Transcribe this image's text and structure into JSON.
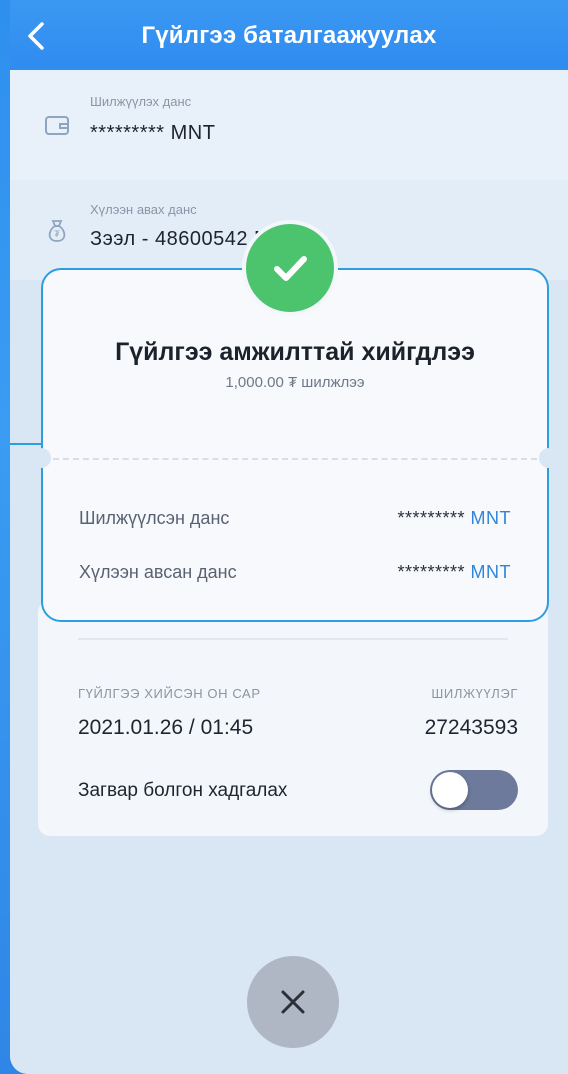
{
  "header": {
    "title": "Гүйлгээ баталгаажуулах"
  },
  "from_account": {
    "label": "Шилжүүлэх данс",
    "value": "********* MNT"
  },
  "to_account": {
    "label": "Хүлээн авах данс",
    "value": "Зээл - 48600542 MNT"
  },
  "modal": {
    "title": "Гүйлгээ амжилттай хийгдлээ",
    "subtitle": "1,000.00 ₮ шилжлээ",
    "rows": [
      {
        "label": "Шилжүүлсэн данс",
        "masked": "*********",
        "currency": "MNT"
      },
      {
        "label": "Хүлээн авсан данс",
        "masked": "*********",
        "currency": "MNT"
      }
    ]
  },
  "details": {
    "date_label": "ГҮЙЛГЭЭ ХИЙСЭН ОН САР",
    "date_value": "2021.01.26 / 01:45",
    "ref_label": "ШИЛЖҮҮЛЭГ",
    "ref_value": "27243593",
    "save_template_label": "Загвар болгон хадгалах",
    "save_template_on": false
  },
  "colors": {
    "accent": "#2f8cf0",
    "success": "#4cc46d",
    "popup_border": "#2d9de0",
    "toggle_off": "#6d7a9b"
  },
  "icons": [
    "chevron-left-icon",
    "wallet-icon",
    "money-bag-icon",
    "checkmark-icon",
    "close-icon"
  ]
}
